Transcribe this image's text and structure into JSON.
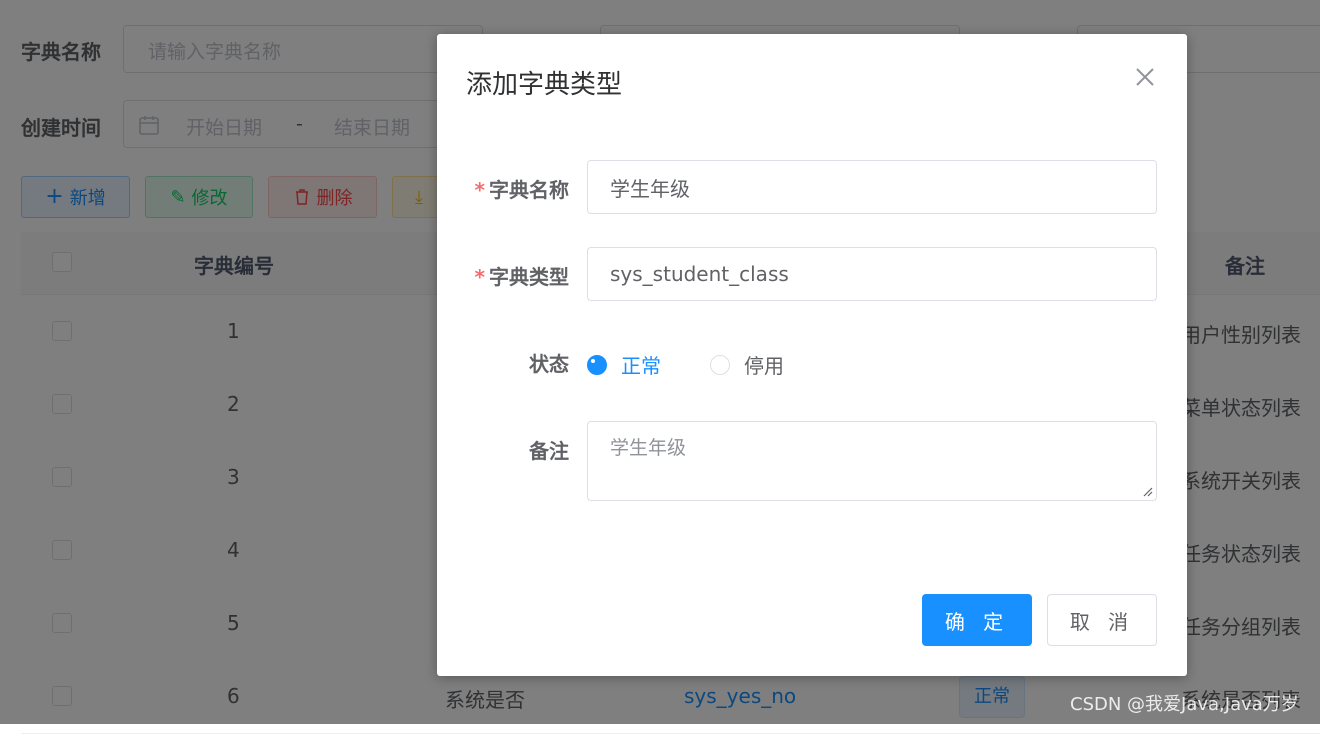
{
  "search": {
    "dict_name_label": "字典名称",
    "dict_name_placeholder": "请输入字典名称",
    "create_time_label": "创建时间",
    "start_date_placeholder": "开始日期",
    "date_separator": "-",
    "end_date_placeholder": "结束日期"
  },
  "toolbar": {
    "add_label": "新增",
    "edit_label": "修改",
    "delete_label": "删除"
  },
  "table": {
    "col_id": "字典编号",
    "col_remark": "备注",
    "rows": [
      {
        "id": "1",
        "remark": "用户性别列表"
      },
      {
        "id": "2",
        "remark": "菜单状态列表"
      },
      {
        "id": "3",
        "remark": "系统开关列表"
      },
      {
        "id": "4",
        "remark": "任务状态列表"
      },
      {
        "id": "5",
        "remark": "任务分组列表"
      },
      {
        "id": "6",
        "name": "系统是否",
        "type": "sys_yes_no",
        "status": "正常",
        "remark": "系统是否列表"
      }
    ]
  },
  "dialog": {
    "title": "添加字典类型",
    "required_mark": "*",
    "name_label": "字典名称",
    "name_value": "学生年级",
    "type_label": "字典类型",
    "type_value": "sys_student_class",
    "status_label": "状态",
    "status_options": [
      "正常",
      "停用"
    ],
    "status_selected": "正常",
    "remark_label": "备注",
    "remark_value": "学生年级",
    "confirm_label": "确 定",
    "cancel_label": "取 消"
  },
  "watermark": "CSDN @我爱Java,Java万岁",
  "colors": {
    "primary": "#1890ff",
    "required": "#f56c6c",
    "success": "#67c23a",
    "danger": "#f56c6c",
    "warning": "#e6a23c"
  }
}
